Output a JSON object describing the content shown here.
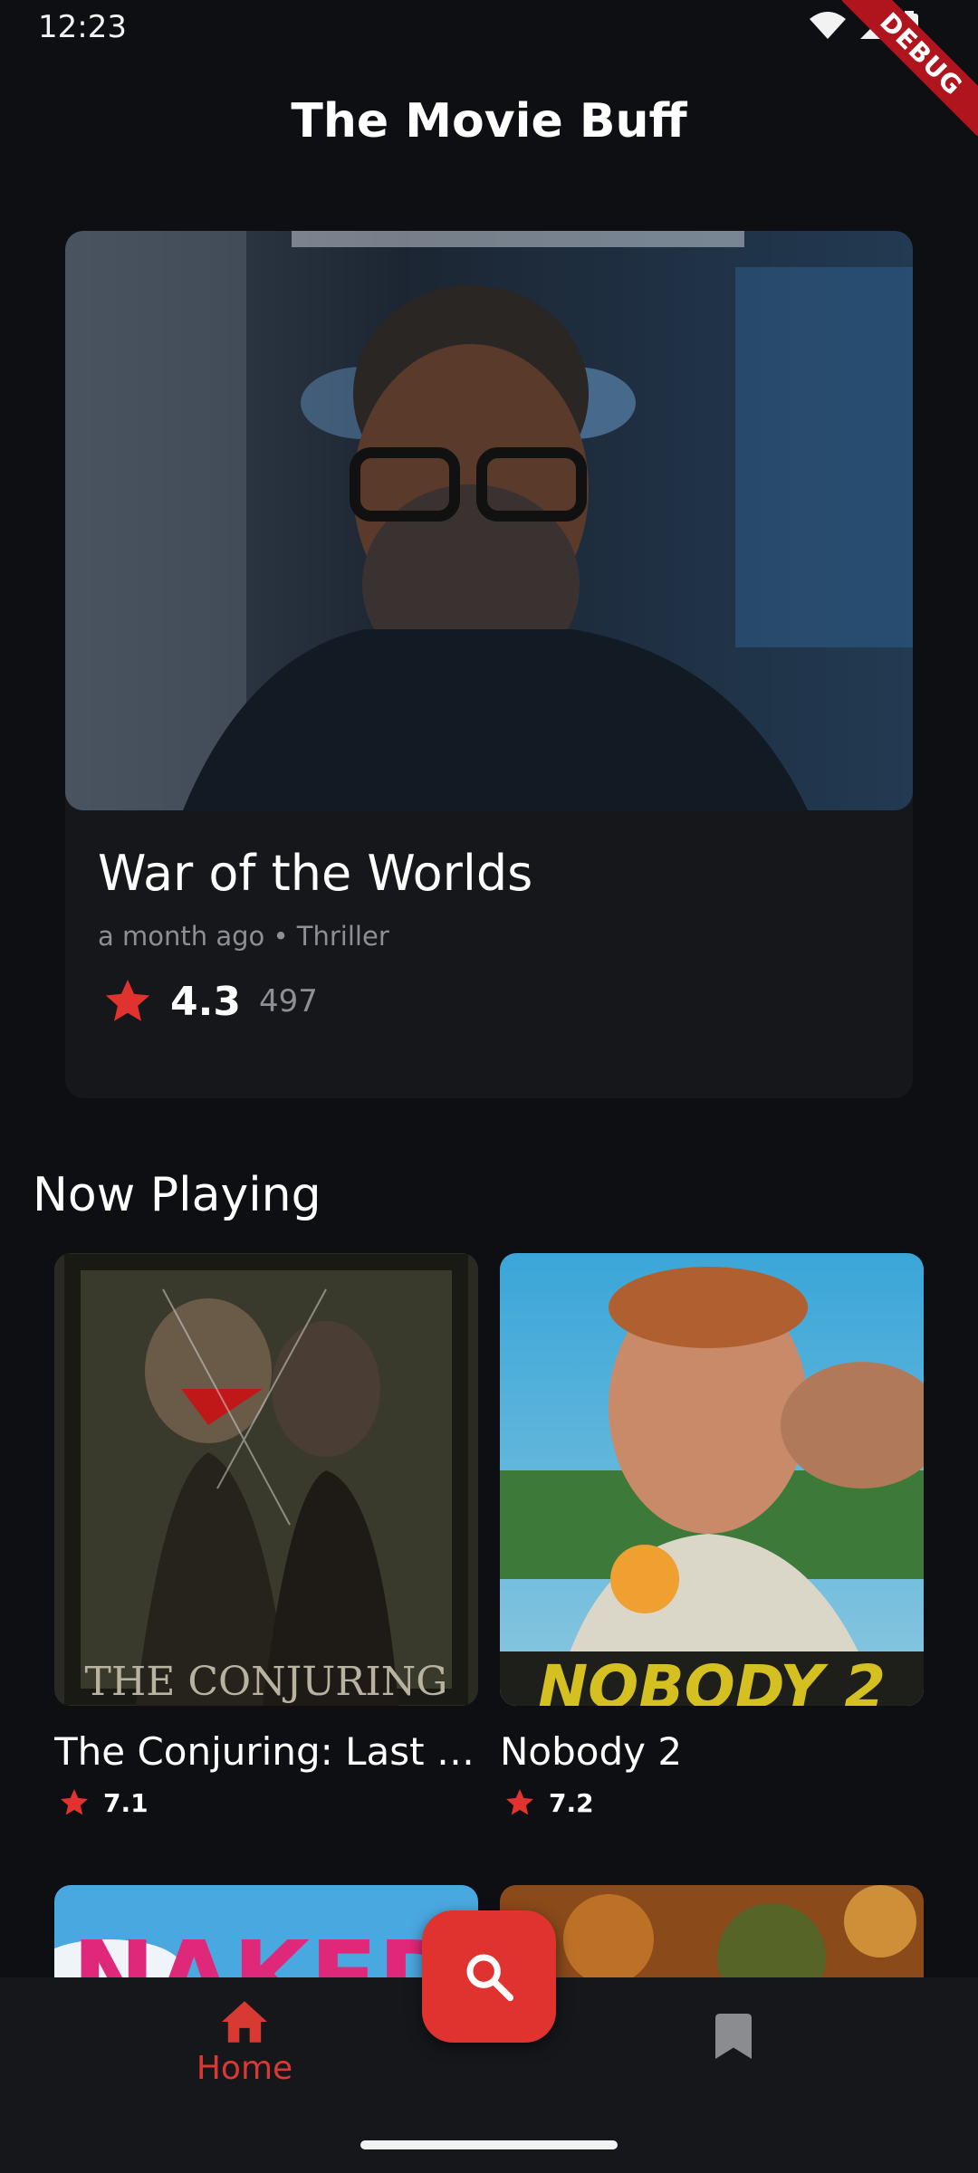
{
  "status_bar": {
    "time": "12:23",
    "debug_label": "DEBUG"
  },
  "app": {
    "title": "The Movie Buff"
  },
  "featured": {
    "title": "War of the Worlds",
    "meta": "a month ago • Thriller",
    "rating": "4.3",
    "votes": "497"
  },
  "now_playing": {
    "heading": "Now Playing",
    "movies": [
      {
        "title": "The Conjuring: Last Rites",
        "rating": "7.1",
        "poster_text": "THE CONJURING"
      },
      {
        "title": "Nobody 2",
        "rating": "7.2",
        "poster_text": "NOBODY 2"
      }
    ],
    "peek_poster_text": "NAKED"
  },
  "nav": {
    "home_label": "Home"
  },
  "colors": {
    "accent": "#e0332f",
    "background": "#0e0f12",
    "card": "#15171b",
    "muted_text": "#8d8f95"
  },
  "icons": [
    "wifi-icon",
    "signal-icon",
    "battery-icon",
    "star-icon",
    "search-icon",
    "home-icon",
    "bookmark-icon"
  ]
}
